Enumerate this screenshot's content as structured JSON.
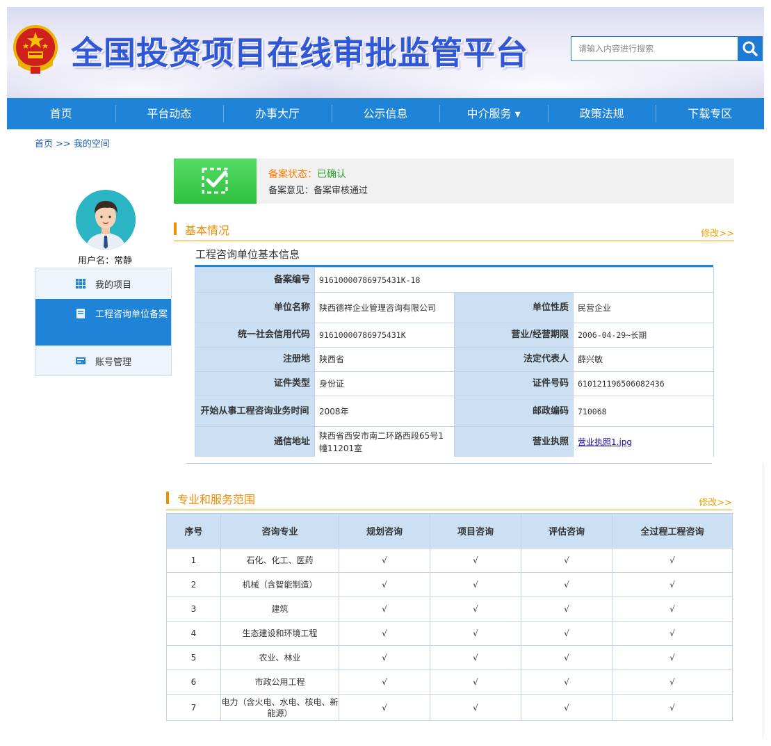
{
  "header": {
    "site_title": "全国投资项目在线审批监管平台",
    "search_placeholder": "请输入内容进行搜索",
    "emblem_icon": "national-emblem-icon",
    "search_icon": "search-icon"
  },
  "nav": {
    "items": [
      {
        "label": "首页"
      },
      {
        "label": "平台动态"
      },
      {
        "label": "办事大厅"
      },
      {
        "label": "公示信息"
      },
      {
        "label": "中介服务 ▾"
      },
      {
        "label": "政策法规"
      },
      {
        "label": "下载专区"
      }
    ]
  },
  "breadcrumb": {
    "home": "首页",
    "separator": ">>",
    "current": "我的空间"
  },
  "sidebar": {
    "username": "用户名：常静",
    "items": [
      {
        "label": "我的项目",
        "icon": "grid-icon"
      },
      {
        "label": "工程咨询单位备案",
        "icon": "document-icon"
      },
      {
        "label": "账号管理",
        "icon": "id-card-icon"
      }
    ]
  },
  "status": {
    "status_label": "备案状态：",
    "status_value": "已确认",
    "opinion_label": "备案意见：",
    "opinion_value": "备案审核通过"
  },
  "basic": {
    "section_title": "基本情况",
    "edit_label": "修改>>",
    "subtitle": "工程咨询单位基本信息",
    "rows": {
      "record_no_label": "备案编号",
      "record_no": "91610000786975431K-18",
      "name_label": "单位名称",
      "name": "陕西德祥企业管理咨询有限公司",
      "nature_label": "单位性质",
      "nature": "民营企业",
      "credit_label": "统一社会信用代码",
      "credit": "91610000786975431K",
      "term_label": "营业/经营期限",
      "term": "2006-04-29~长期",
      "reg_label": "注册地",
      "reg": "陕西省",
      "legal_label": "法定代表人",
      "legal": "薛兴敏",
      "idtype_label": "证件类型",
      "idtype": "身份证",
      "idno_label": "证件号码",
      "idno": "610121196506082436",
      "start_label": "开始从事工程咨询业务时间",
      "start": "2008年",
      "post_label": "邮政编码",
      "post": "710068",
      "addr_label": "通信地址",
      "addr": "陕西省西安市南二环路西段65号1幢11201室",
      "license_label": "营业执照",
      "license": "营业执照1.jpg"
    }
  },
  "scope": {
    "section_title": "专业和服务范围",
    "edit_label": "修改>>",
    "columns": [
      "序号",
      "咨询专业",
      "规划咨询",
      "项目咨询",
      "评估咨询",
      "全过程工程咨询"
    ],
    "rows": [
      {
        "no": "1",
        "major": "石化、化工、医药",
        "a": "√",
        "b": "√",
        "c": "√",
        "d": "√"
      },
      {
        "no": "2",
        "major": "机械（含智能制造）",
        "a": "√",
        "b": "√",
        "c": "√",
        "d": "√"
      },
      {
        "no": "3",
        "major": "建筑",
        "a": "√",
        "b": "√",
        "c": "√",
        "d": "√"
      },
      {
        "no": "4",
        "major": "生态建设和环境工程",
        "a": "√",
        "b": "√",
        "c": "√",
        "d": "√"
      },
      {
        "no": "5",
        "major": "农业、林业",
        "a": "√",
        "b": "√",
        "c": "√",
        "d": "√"
      },
      {
        "no": "6",
        "major": "市政公用工程",
        "a": "√",
        "b": "√",
        "c": "√",
        "d": "√"
      },
      {
        "no": "7",
        "major": "电力（含火电、水电、核电、新能源）",
        "a": "√",
        "b": "√",
        "c": "√",
        "d": "√"
      }
    ]
  },
  "colors": {
    "nav_blue": "#1f84d8",
    "title_blue": "#2f57d6",
    "accent_orange": "#f08a00",
    "label_cell": "#cbe0f3",
    "confirm_green": "#2aa52a"
  }
}
